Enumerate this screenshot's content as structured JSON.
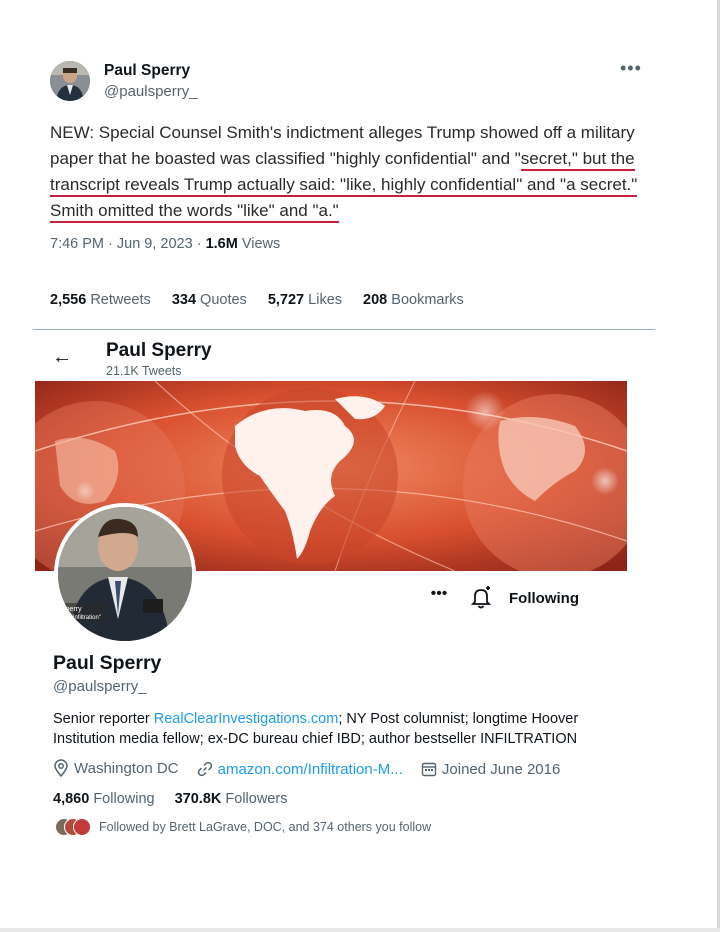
{
  "tweet": {
    "author_name": "Paul Sperry",
    "author_handle": "@paulsperry_",
    "more_icon": "more-horizontal-icon",
    "text_part1": "NEW: Special Counsel Smith's indictment alleges Trump showed off a military paper that he boasted was classified \"highly confidential\" and \"",
    "text_underlined": "secret,\" but the transcript reveals Trump actually said: \"like, highly confidential\" and \"a secret.\" Smith omitted the words \"like\" and \"a.\"",
    "time": "7:46 PM · Jun 9, 2023 · ",
    "views_count": "1.6M",
    "views_label": " Views",
    "stats": [
      {
        "count": "2,556",
        "label": " Retweets"
      },
      {
        "count": "334",
        "label": " Quotes"
      },
      {
        "count": "5,727",
        "label": " Likes"
      },
      {
        "count": "208",
        "label": " Bookmarks"
      }
    ]
  },
  "profile_header": {
    "back_icon": "back-arrow-icon",
    "name": "Paul Sperry",
    "tweet_count": "21.1K Tweets"
  },
  "profile": {
    "avatar_caption_line1": "Sperry",
    "avatar_caption_line2": "ex. \"Infiltration\"",
    "more_label": "•••",
    "following_button": "Following",
    "name": "Paul Sperry",
    "handle": "@paulsperry_",
    "bio_before": "Senior reporter ",
    "bio_link": "RealClearInvestigations.com",
    "bio_after": "; NY Post columnist; longtime Hoover Institution media fellow; ex-DC bureau chief IBD; author bestseller INFILTRATION",
    "location": "Washington DC",
    "website": "amazon.com/Infiltration-M...",
    "joined": "Joined June 2016",
    "following_count": "4,860",
    "following_label": " Following",
    "followers_count": "370.8K",
    "followers_label": " Followers",
    "followed_by": "Followed by Brett LaGrave, DOC, and 374 others you follow"
  },
  "colors": {
    "accent_blue": "#1d9bf0",
    "underline_red": "#c8203a",
    "banner_red": "#d9502f"
  }
}
